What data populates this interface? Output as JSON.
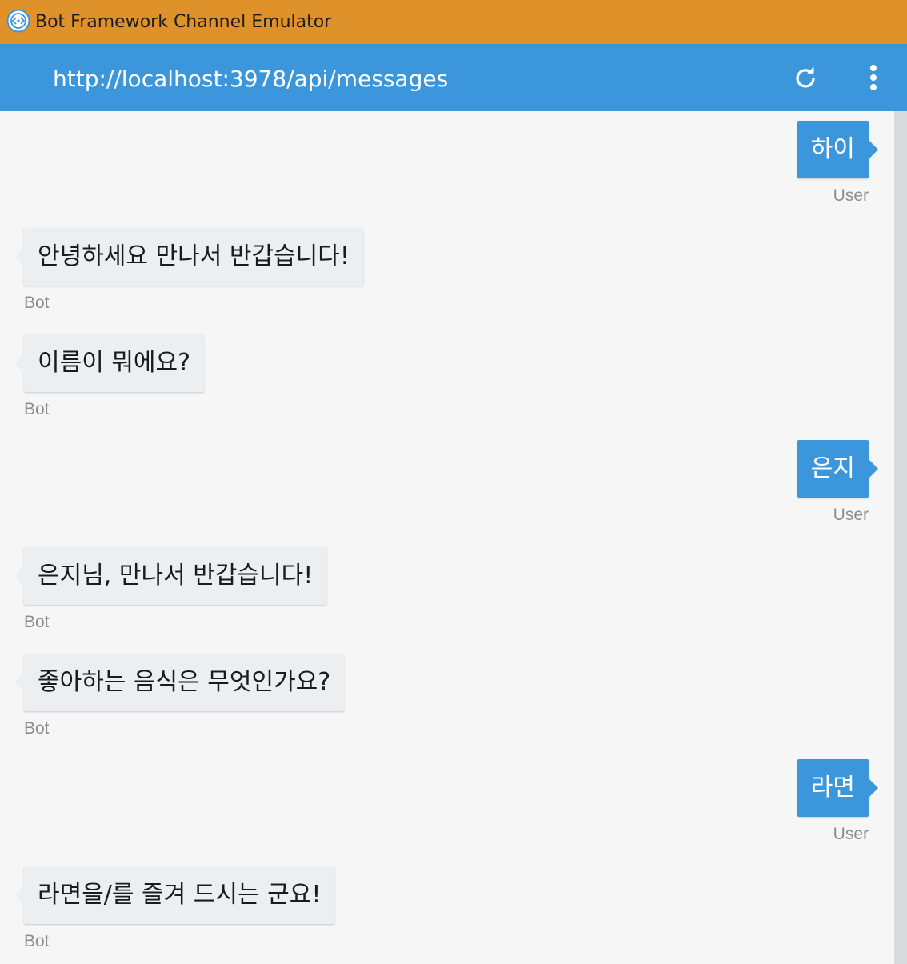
{
  "window": {
    "title": "Bot Framework Channel Emulator",
    "colors": {
      "titlebar": "#df922a",
      "addressbar": "#3c96dc",
      "user_bubble": "#3c96dc",
      "bot_bubble": "#eceff1",
      "chat_background": "#f6f6f6"
    }
  },
  "addressbar": {
    "url": "http://localhost:3978/api/messages",
    "refresh_icon": "refresh-icon",
    "menu_icon": "more-vertical-icon"
  },
  "messages": [
    {
      "from": "user",
      "text": "하이",
      "sender": "User"
    },
    {
      "from": "bot",
      "text": "안녕하세요 만나서 반갑습니다!",
      "sender": "Bot"
    },
    {
      "from": "bot",
      "text": "이름이 뭐에요?",
      "sender": "Bot"
    },
    {
      "from": "user",
      "text": "은지",
      "sender": "User"
    },
    {
      "from": "bot",
      "text": "은지님, 만나서 반갑습니다!",
      "sender": "Bot"
    },
    {
      "from": "bot",
      "text": "좋아하는 음식은 무엇인가요?",
      "sender": "Bot"
    },
    {
      "from": "user",
      "text": "라면",
      "sender": "User"
    },
    {
      "from": "bot",
      "text": "라면을/를 즐겨 드시는 군요!",
      "sender": "Bot"
    }
  ]
}
